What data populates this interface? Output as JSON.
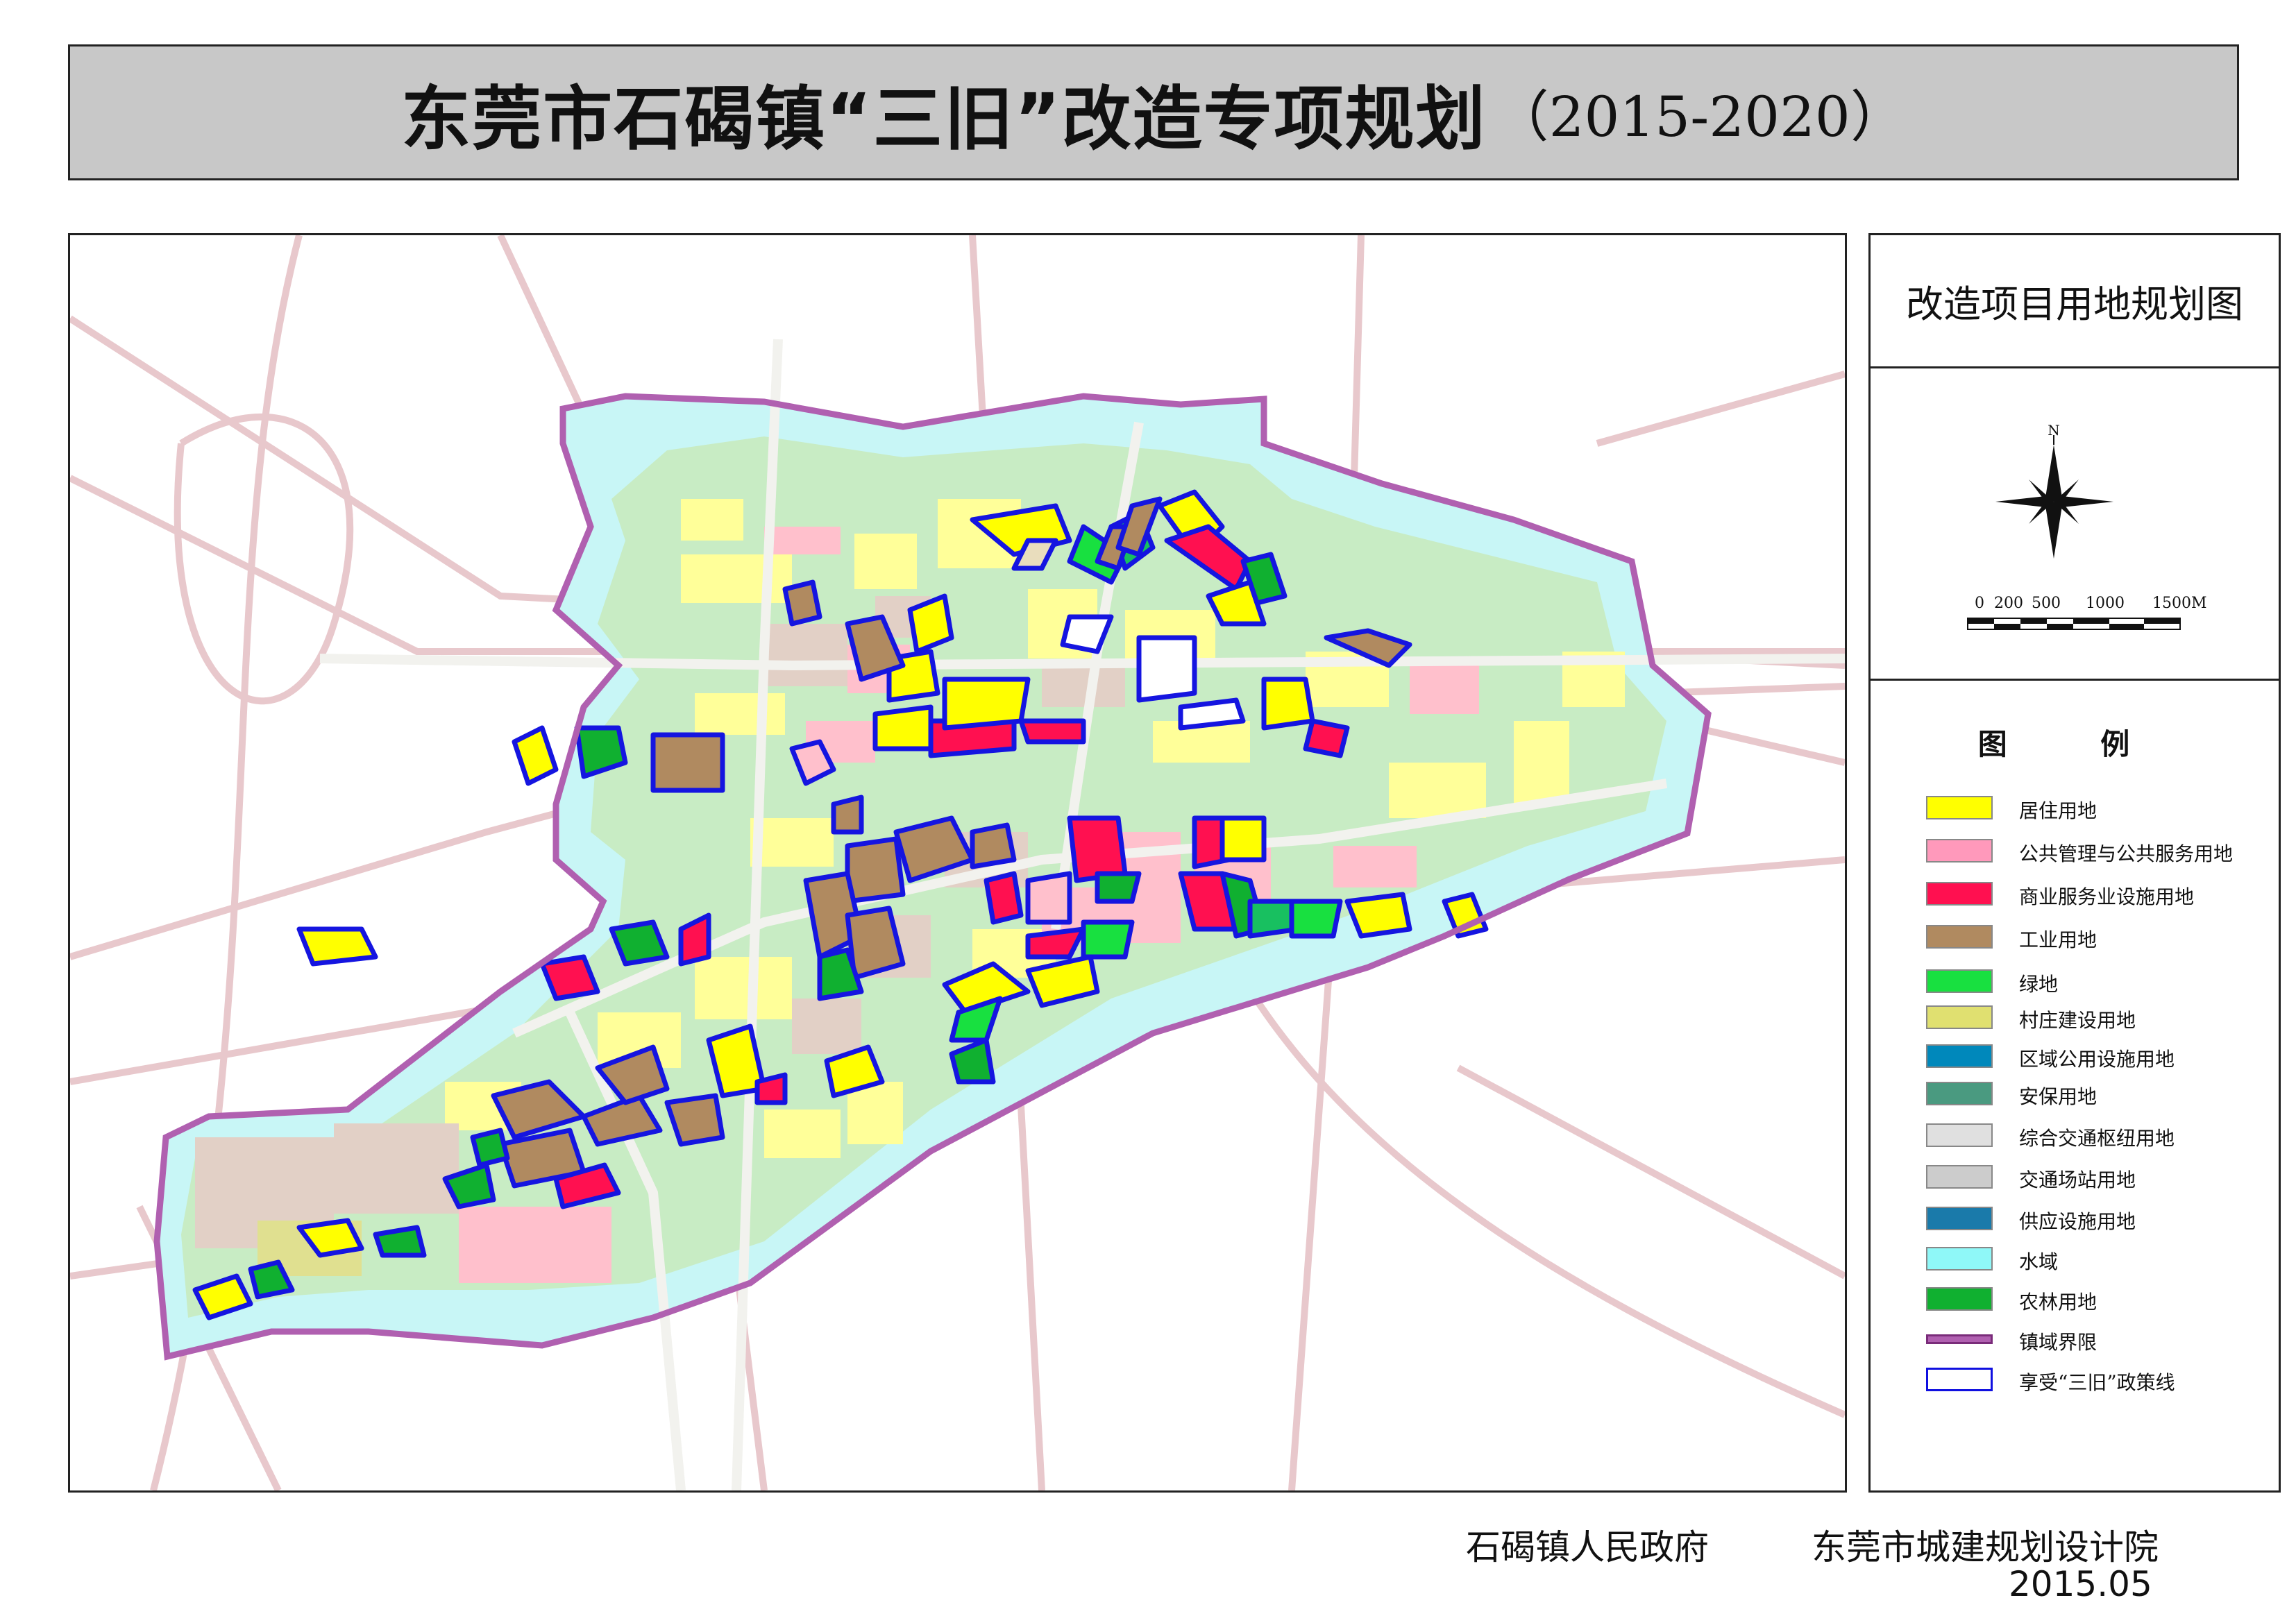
{
  "title": {
    "main": "东莞市石碣镇“三旧”改造专项规划",
    "years": "（2015-2020）"
  },
  "panel": {
    "map_title": "改造项目用地规划图",
    "north": "N",
    "scale": {
      "labels": [
        "0",
        "200",
        "500",
        "1000",
        "1500M"
      ]
    },
    "legend_heading": "图  例",
    "legend": [
      {
        "label": "居住用地",
        "color": "#ffff00",
        "kind": "fill"
      },
      {
        "label": "公共管理与公共服务用地",
        "color": "#ff99bb",
        "kind": "fill"
      },
      {
        "label": "商业服务业设施用地",
        "color": "#ff1050",
        "kind": "fill"
      },
      {
        "label": "工业用地",
        "color": "#b08a60",
        "kind": "fill"
      },
      {
        "label": "绿地",
        "color": "#18e040",
        "kind": "fill"
      },
      {
        "label": "村庄建设用地",
        "color": "#e0e070",
        "kind": "fill"
      },
      {
        "label": "区域公用设施用地",
        "color": "#0088bb",
        "kind": "fill"
      },
      {
        "label": "安保用地",
        "color": "#4a9a80",
        "kind": "fill"
      },
      {
        "label": "综合交通枢纽用地",
        "color": "#e0e0e0",
        "kind": "fill"
      },
      {
        "label": "交通场站用地",
        "color": "#cccccc",
        "kind": "fill"
      },
      {
        "label": "供应设施用地",
        "color": "#1a7aaa",
        "kind": "fill"
      },
      {
        "label": "水域",
        "color": "#8ff8f8",
        "kind": "fill"
      },
      {
        "label": "农林用地",
        "color": "#10b030",
        "kind": "fill"
      },
      {
        "label": "镇域界限",
        "color": "#b060b0",
        "kind": "boundary"
      },
      {
        "label": "享受“三旧”政策线",
        "color": "#1010e0",
        "kind": "policy"
      }
    ]
  },
  "footer": {
    "government": "石碣镇人民政府",
    "institute": "东莞市城建规划设计院",
    "date": "2015.05"
  }
}
